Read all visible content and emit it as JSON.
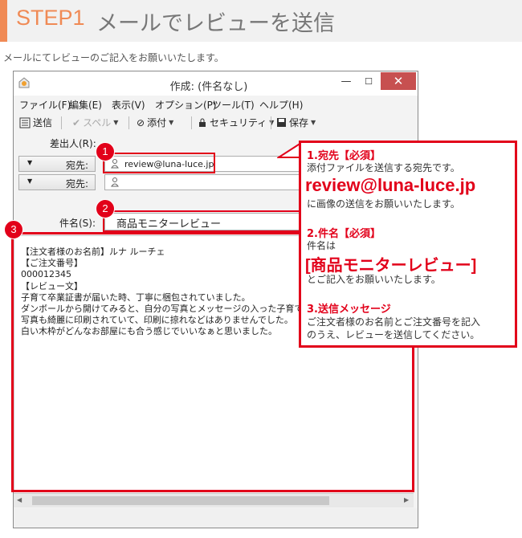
{
  "header": {
    "step": "STEP1",
    "title": "メールでレビューを送信",
    "subtitle": "メールにてレビューのご記入をお願いいたします。"
  },
  "window": {
    "title": "作成: (件名なし)",
    "menu": [
      "ファイル(F)",
      "編集(E)",
      "表示(V)",
      "オプション(P)",
      "ツール(T)",
      "ヘルプ(H)"
    ],
    "toolbar": {
      "send": "送信",
      "spell": "スペル",
      "attach": "添付",
      "security": "セキュリティ",
      "save": "保存"
    },
    "fields": {
      "from_label": "差出人(R):",
      "to_label": "宛先:",
      "to_value": "review@luna-luce.jp",
      "to2_label": "宛先:",
      "subject_label": "件名(S):",
      "subject_value": "商品モニターレビュー"
    },
    "body": "【注文者様のお名前】ルナ ルーチェ\n【ご注文番号】\n000012345\n【レビュー文】\n子育て卒業証書が届いた時、丁寧に梱包されていました。\nダンボールから開けてみると、自分の写真とメッセージの入った子育て\n写真も綺麗に印刷されていて、印刷に掠れなどはありませんでした。\n白い木枠がどんなお部屋にも合う感じでいいなぁと思いました。"
  },
  "badges": [
    "1",
    "2",
    "3"
  ],
  "note": {
    "s1_heading": "1.宛先【必須】",
    "s1_text": "添付ファイルを送信する宛先です。",
    "s1_address": "review@luna-luce.jp",
    "s1_text2": "に画像の送信をお願いいたします。",
    "s2_heading": "2.件名【必須】",
    "s2_text": "件名は",
    "s2_subject": "[商品モニターレビュー]",
    "s2_text2": "とご記入をお願いいたします。",
    "s3_heading": "3.送信メッセージ",
    "s3_text1": "ご注文者様のお名前とご注文番号を記入",
    "s3_text2": "のうえ、レビューを送信してください。"
  },
  "colors": {
    "accent": "#f08a55",
    "callout": "#e2001a"
  }
}
